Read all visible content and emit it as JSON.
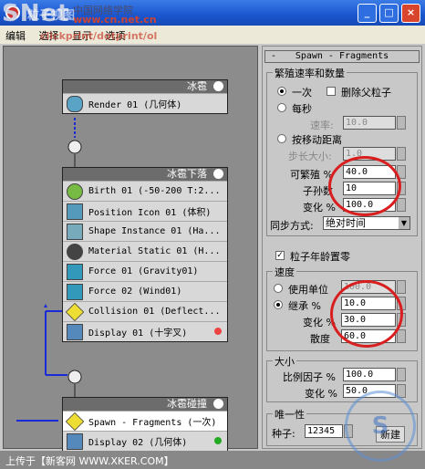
{
  "window": {
    "title": "粒子视图",
    "watermark": "SNet",
    "watermark_line1": "中国网络学院",
    "watermark_line2": "www.cn.net.cn"
  },
  "menu": {
    "items": [
      "编辑",
      "选择",
      "显示",
      "选项"
    ],
    "watermark": "clickprint/dotprint/ol"
  },
  "nodes": {
    "hail": {
      "title": "冰雹",
      "rows": [
        "Render 01 (几何体)"
      ]
    },
    "fall": {
      "title": "冰雹下落",
      "rows": [
        "Birth 01 (-50-200 T:2...",
        "Position Icon 01 (体积)",
        "Shape Instance 01 (Ha...",
        "Material Static 01 (H...",
        "Force 01 (Gravity01)",
        "Force 02 (Wind01)",
        "Collision 01 (Deflect...",
        "Display 01 (十字叉)"
      ]
    },
    "hit": {
      "title": "冰雹碰撞",
      "rows": [
        "Spawn - Fragments (一次)",
        "Display 02 (几何体)"
      ]
    }
  },
  "panel": {
    "rollout_title": "Spawn - Fragments",
    "group_rate": "繁殖速率和数量",
    "once": "一次",
    "delete_parent": "删除父粒子",
    "per_second": "每秒",
    "rate_label": "速率:",
    "rate_value": "10.0",
    "by_distance": "按移动距离",
    "step_label": "步长大小:",
    "step_value": "1.0",
    "spawnable_label": "可繁殖 %",
    "spawnable_value": "40.0",
    "offspring_label": "子孙数",
    "offspring_value": "10",
    "variation_label": "变化 %",
    "variation_value": "100.0",
    "sync_label": "同步方式:",
    "sync_value": "绝对时间",
    "restart_age": "粒子年龄置零",
    "group_speed": "速度",
    "use_units": "使用单位",
    "use_units_value": "100.0",
    "inherit": "继承 %",
    "inherit_value": "10.0",
    "speed_var_label": "变化 %",
    "speed_var_value": "30.0",
    "divergence_label": "散度",
    "divergence_value": "60.0",
    "group_size": "大小",
    "scale_label": "比例因子 %",
    "scale_value": "100.0",
    "size_var_label": "变化 %",
    "size_var_value": "50.0",
    "group_unique": "唯一性",
    "seed_label": "种子:",
    "seed_value": "12345",
    "new_button": "新建"
  },
  "status": {
    "text": "上传于【新客网 WWW.XKER.COM】",
    "stamp": "S"
  }
}
